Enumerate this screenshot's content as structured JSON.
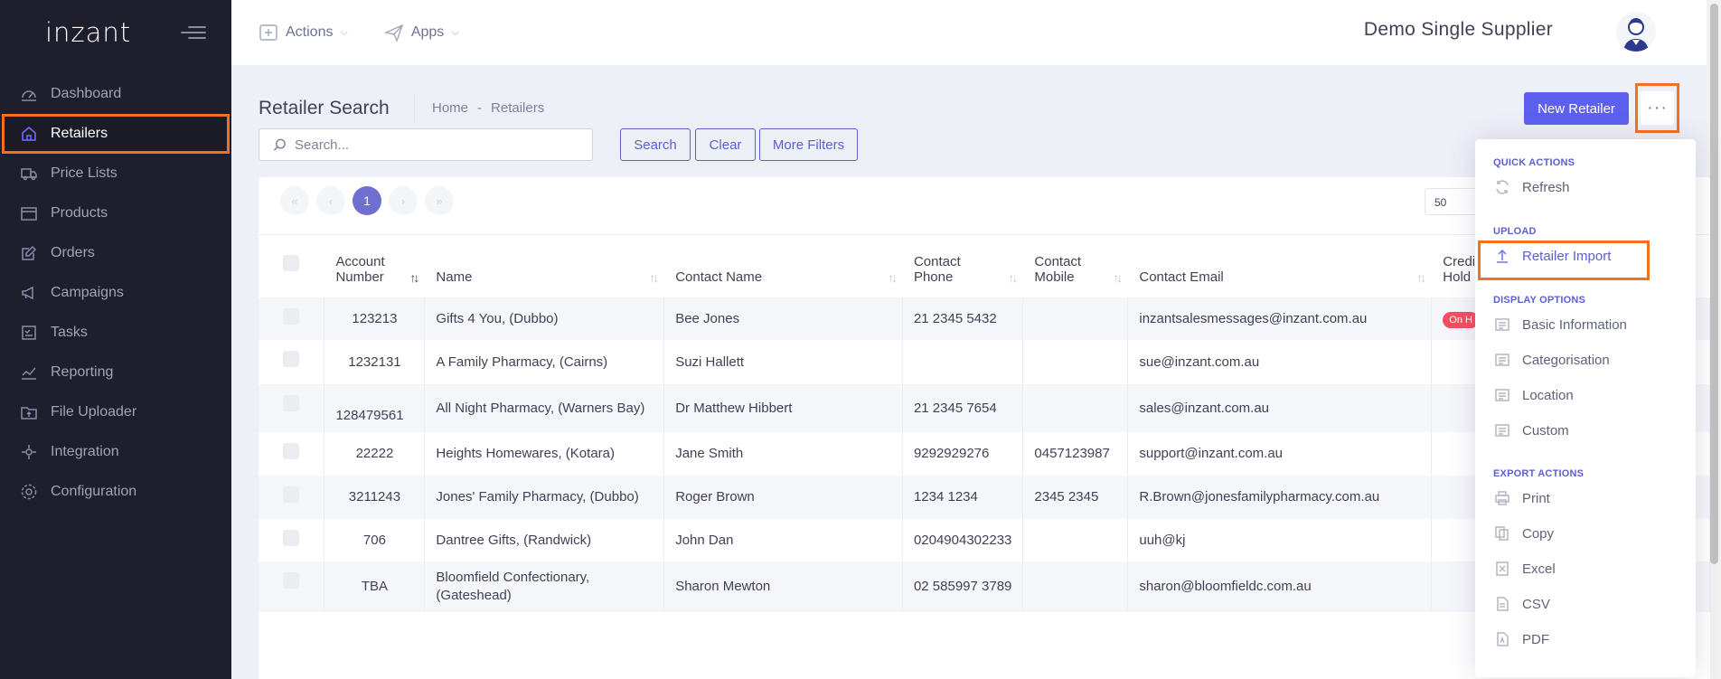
{
  "app": {
    "logo": "inzant",
    "supplier_name": "Demo Single Supplier"
  },
  "topbar": {
    "actions_label": "Actions",
    "apps_label": "Apps"
  },
  "sidebar": {
    "items": [
      {
        "label": "Dashboard",
        "icon": "dashboard-icon"
      },
      {
        "label": "Retailers",
        "icon": "home-icon",
        "active": true
      },
      {
        "label": "Price Lists",
        "icon": "truck-icon"
      },
      {
        "label": "Products",
        "icon": "box-icon"
      },
      {
        "label": "Orders",
        "icon": "edit-icon"
      },
      {
        "label": "Campaigns",
        "icon": "megaphone-icon"
      },
      {
        "label": "Tasks",
        "icon": "checklist-icon"
      },
      {
        "label": "Reporting",
        "icon": "chart-icon"
      },
      {
        "label": "File Uploader",
        "icon": "upload-folder-icon"
      },
      {
        "label": "Integration",
        "icon": "integration-icon"
      },
      {
        "label": "Configuration",
        "icon": "gear-icon"
      }
    ]
  },
  "page": {
    "title": "Retailer Search",
    "breadcrumb": [
      "Home",
      "-",
      "Retailers"
    ],
    "search_placeholder": "Search...",
    "search_button": "Search",
    "clear_button": "Clear",
    "more_filters_button": "More Filters",
    "new_retailer_button": "New Retailer",
    "more_button": "···"
  },
  "pagination": {
    "current_page": "1",
    "page_size": "50"
  },
  "table": {
    "headers": {
      "account_number": [
        "Account",
        "Number"
      ],
      "name": "Name",
      "contact_name": "Contact Name",
      "contact_phone": [
        "Contact",
        "Phone"
      ],
      "contact_mobile": [
        "Contact",
        "Mobile"
      ],
      "contact_email": "Contact Email",
      "credit_hold": [
        "Credi",
        "Hold"
      ]
    },
    "rows": [
      {
        "account": "123213",
        "name": "Gifts 4 You, (Dubbo)",
        "contact": "Bee Jones",
        "phone": "21 2345 5432",
        "mobile": "",
        "email": "inzantsalesmessages@inzant.com.au",
        "credit": "On H"
      },
      {
        "account": "1232131",
        "name": "A Family Pharmacy, (Cairns)",
        "contact": "Suzi Hallett",
        "phone": "",
        "mobile": "",
        "email": "sue@inzant.com.au",
        "credit": ""
      },
      {
        "account": "128479561",
        "name": "All Night Pharmacy, (Warners Bay)",
        "contact": "Dr Matthew Hibbert",
        "phone": "21 2345 7654",
        "mobile": "",
        "email": "sales@inzant.com.au",
        "credit": ""
      },
      {
        "account": "22222",
        "name": "Heights Homewares, (Kotara)",
        "contact": "Jane Smith",
        "phone": "9292929276",
        "mobile": "0457123987",
        "email": "support@inzant.com.au",
        "credit": ""
      },
      {
        "account": "3211243",
        "name": "Jones' Family Pharmacy, (Dubbo)",
        "contact": "Roger Brown",
        "phone": "1234 1234",
        "mobile": "2345 2345",
        "email": "R.Brown@jonesfamilypharmacy.com.au",
        "credit": ""
      },
      {
        "account": "706",
        "name": "Dantree Gifts, (Randwick)",
        "contact": "John Dan",
        "phone": "0204904302233",
        "mobile": "",
        "email": "uuh@kj",
        "credit": ""
      },
      {
        "account": "TBA",
        "name": "Bloomfield Confectionary, (Gateshead)",
        "contact": "Sharon Mewton",
        "phone": "02 585997 3789",
        "mobile": "",
        "email": "sharon@bloomfieldc.com.au",
        "credit": ""
      }
    ]
  },
  "dropdown": {
    "quick_actions": "QUICK ACTIONS",
    "refresh": "Refresh",
    "upload": "UPLOAD",
    "retailer_import": "Retailer Import",
    "display_options": "DISPLAY OPTIONS",
    "basic_information": "Basic Information",
    "categorisation": "Categorisation",
    "location": "Location",
    "custom": "Custom",
    "export_actions": "EXPORT ACTIONS",
    "print": "Print",
    "copy": "Copy",
    "excel": "Excel",
    "csv": "CSV",
    "pdf": "PDF"
  },
  "colors": {
    "sidebar_bg": "#1e1e2d",
    "primary": "#5d5fef",
    "highlight": "#f37021",
    "danger": "#f64e60"
  }
}
